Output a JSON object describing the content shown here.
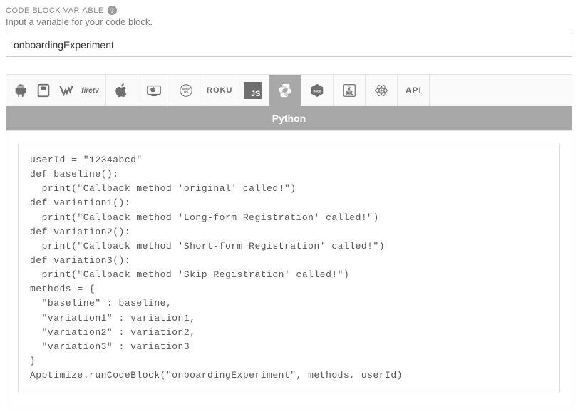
{
  "label": "CODE BLOCK VARIABLE",
  "hint": "Input a variable for your code block.",
  "input_value": "onboardingExperiment",
  "tabs": [
    {
      "name": "android-icon"
    },
    {
      "name": "android-tablet-icon"
    },
    {
      "name": "wear-os-icon"
    },
    {
      "name": "firetv-icon"
    },
    {
      "name": "apple-icon"
    },
    {
      "name": "apple-tv-icon"
    },
    {
      "name": "watchos-icon"
    },
    {
      "name": "roku-icon"
    },
    {
      "name": "js-icon"
    },
    {
      "name": "python-icon"
    },
    {
      "name": "node-icon"
    },
    {
      "name": "java-icon"
    },
    {
      "name": "react-icon"
    },
    {
      "name": "api-text"
    }
  ],
  "active_tab_index": 9,
  "language_label": "Python",
  "api_label": "API",
  "roku_label": "ROKU",
  "js_label": "JS",
  "firetv_label": "firetv",
  "code": "userId = \"1234abcd\"\ndef baseline():\n  print(\"Callback method 'original' called!\")\ndef variation1():\n  print(\"Callback method 'Long-form Registration' called!\")\ndef variation2():\n  print(\"Callback method 'Short-form Registration' called!\")\ndef variation3():\n  print(\"Callback method 'Skip Registration' called!\")\nmethods = {\n  \"baseline\" : baseline,\n  \"variation1\" : variation1,\n  \"variation2\" : variation2,\n  \"variation3\" : variation3\n}\nApptimize.runCodeBlock(\"onboardingExperiment\", methods, userId)"
}
